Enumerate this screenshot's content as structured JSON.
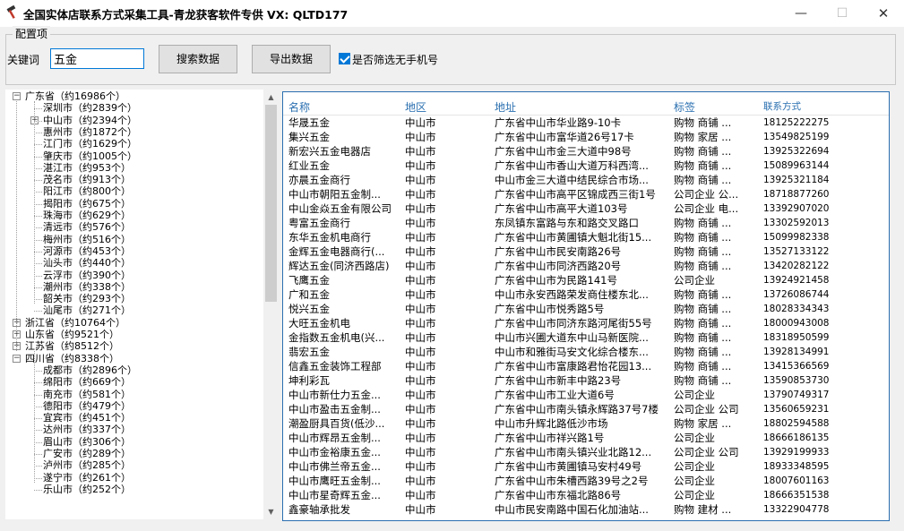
{
  "window": {
    "title": "全国实体店联系方式采集工具-青龙获客软件专供 VX:  QLTD177",
    "minimize": "—",
    "maximize": "☐",
    "close": "✕"
  },
  "config": {
    "group_label": "配置项",
    "keyword_label": "关键词",
    "keyword_value": "五金",
    "search_button": "搜索数据",
    "export_button": "导出数据",
    "filter_checkbox_label": "是否筛选无手机号",
    "filter_checked": true
  },
  "tree": [
    {
      "label": "广东省（约16986个）",
      "level": 0,
      "exp": "−"
    },
    {
      "label": "深圳市（约2839个）",
      "level": 1,
      "exp": ""
    },
    {
      "label": "中山市（约2394个）",
      "level": 1,
      "exp": "+"
    },
    {
      "label": "惠州市（约1872个）",
      "level": 1,
      "exp": ""
    },
    {
      "label": "江门市（约1629个）",
      "level": 1,
      "exp": ""
    },
    {
      "label": "肇庆市（约1005个）",
      "level": 1,
      "exp": ""
    },
    {
      "label": "湛江市（约953个）",
      "level": 1,
      "exp": ""
    },
    {
      "label": "茂名市（约913个）",
      "level": 1,
      "exp": ""
    },
    {
      "label": "阳江市（约800个）",
      "level": 1,
      "exp": ""
    },
    {
      "label": "揭阳市（约675个）",
      "level": 1,
      "exp": ""
    },
    {
      "label": "珠海市（约629个）",
      "level": 1,
      "exp": ""
    },
    {
      "label": "清远市（约576个）",
      "level": 1,
      "exp": ""
    },
    {
      "label": "梅州市（约516个）",
      "level": 1,
      "exp": ""
    },
    {
      "label": "河源市（约453个）",
      "level": 1,
      "exp": ""
    },
    {
      "label": "汕头市（约440个）",
      "level": 1,
      "exp": ""
    },
    {
      "label": "云浮市（约390个）",
      "level": 1,
      "exp": ""
    },
    {
      "label": "潮州市（约338个）",
      "level": 1,
      "exp": ""
    },
    {
      "label": "韶关市（约293个）",
      "level": 1,
      "exp": ""
    },
    {
      "label": "汕尾市（约271个）",
      "level": 1,
      "exp": ""
    },
    {
      "label": "浙江省（约10764个）",
      "level": 0,
      "exp": "+"
    },
    {
      "label": "山东省（约9521个）",
      "level": 0,
      "exp": "+"
    },
    {
      "label": "江苏省（约8512个）",
      "level": 0,
      "exp": "+"
    },
    {
      "label": "四川省（约8338个）",
      "level": 0,
      "exp": "−"
    },
    {
      "label": "成都市（约2896个）",
      "level": 1,
      "exp": ""
    },
    {
      "label": "绵阳市（约669个）",
      "level": 1,
      "exp": ""
    },
    {
      "label": "南充市（约581个）",
      "level": 1,
      "exp": ""
    },
    {
      "label": "德阳市（约479个）",
      "level": 1,
      "exp": ""
    },
    {
      "label": "宜宾市（约451个）",
      "level": 1,
      "exp": ""
    },
    {
      "label": "达州市（约337个）",
      "level": 1,
      "exp": ""
    },
    {
      "label": "眉山市（约306个）",
      "level": 1,
      "exp": ""
    },
    {
      "label": "广安市（约289个）",
      "level": 1,
      "exp": ""
    },
    {
      "label": "泸州市（约285个）",
      "level": 1,
      "exp": ""
    },
    {
      "label": "遂宁市（约261个）",
      "level": 1,
      "exp": ""
    },
    {
      "label": "乐山市（约252个）",
      "level": 1,
      "exp": ""
    }
  ],
  "list": {
    "headers": [
      "名称",
      "地区",
      "地址",
      "标签",
      "联系方式"
    ],
    "rows": [
      [
        "华晟五金",
        "中山市",
        "广东省中山市华业路9-10卡",
        "购物 商铺 ...",
        "18125222275"
      ],
      [
        "集兴五金",
        "中山市",
        "广东省中山市富华道26号17卡",
        "购物 家居 ...",
        "13549825199"
      ],
      [
        "新宏兴五金电器店",
        "中山市",
        "广东省中山市金三大道中98号",
        "购物 商铺 ...",
        "13925322694"
      ],
      [
        "红业五金",
        "中山市",
        "广东省中山市香山大道万科西湾...",
        "购物 商铺 ...",
        "15089963144"
      ],
      [
        "亦晨五金商行",
        "中山市",
        "中山市金三大道中结民综合市场...",
        "购物 商铺 ...",
        "13925321184"
      ],
      [
        "中山市朝阳五金制...",
        "中山市",
        "广东省中山市高平区锦成西三街1号",
        "公司企业 公...",
        "18718877260"
      ],
      [
        "中山金焱五金有限公司",
        "中山市",
        "广东省中山市高平大道103号",
        "公司企业 电...",
        "13392907020"
      ],
      [
        "粤富五金商行",
        "中山市",
        "东凤镇东富路与东和路交叉路口",
        "购物 商铺 ...",
        "13302592013"
      ],
      [
        "东华五金机电商行",
        "中山市",
        "广东省中山市黄圃镇大魁北街15...",
        "购物 商铺 ...",
        "15099982338"
      ],
      [
        "金辉五金电器商行(...",
        "中山市",
        "广东省中山市民安南路26号",
        "购物 商铺 ...",
        "13527133122"
      ],
      [
        "辉达五金(同济西路店)",
        "中山市",
        "广东省中山市同济西路20号",
        "购物 商铺 ...",
        "13420282122"
      ],
      [
        "飞鹰五金",
        "中山市",
        "广东省中山市为民路141号",
        "公司企业",
        "13924921458"
      ],
      [
        "广和五金",
        "中山市",
        "中山市永安西路荣发商住楼东北...",
        "购物 商铺 ...",
        "13726086744"
      ],
      [
        "悦兴五金",
        "中山市",
        "广东省中山市悦秀路5号",
        "购物 商铺 ...",
        "18028334343"
      ],
      [
        "大旺五金机电",
        "中山市",
        "广东省中山市同济东路河尾街55号",
        "购物 商铺 ...",
        "18000943008"
      ],
      [
        "金指数五金机电(兴...",
        "中山市",
        "中山市兴圃大道东中山马新医院...",
        "购物 商铺 ...",
        "18318950599"
      ],
      [
        "翡宏五金",
        "中山市",
        "中山市和雅街马安文化综合楼东...",
        "购物 商铺 ...",
        "13928134991"
      ],
      [
        "信鑫五金装饰工程部",
        "中山市",
        "广东省中山市富康路君怡花园13...",
        "购物 商铺 ...",
        "13415366569"
      ],
      [
        "坤利彩瓦",
        "中山市",
        "广东省中山市新丰中路23号",
        "购物 商铺 ...",
        "13590853730"
      ],
      [
        "中山市新仕力五金...",
        "中山市",
        "广东省中山市工业大道6号",
        "公司企业",
        "13790749317"
      ],
      [
        "中山市盈击五金制...",
        "中山市",
        "广东省中山市南头镇永辉路37号7楼",
        "公司企业 公司",
        "13560659231"
      ],
      [
        "潮盈厨具百货(低沙...",
        "中山市",
        "中山市升辉北路低沙市场",
        "购物 家居 ...",
        "18802594588"
      ],
      [
        "中山市辉昂五金制...",
        "中山市",
        "广东省中山市祥兴路1号",
        "公司企业",
        "18666186135"
      ],
      [
        "中山市金裕康五金...",
        "中山市",
        "广东省中山市南头镇兴业北路12...",
        "公司企业 公司",
        "13929199933"
      ],
      [
        "中山市佛兰帝五金...",
        "中山市",
        "广东省中山市黄圃镇马安村49号",
        "公司企业",
        "18933348595"
      ],
      [
        "中山市鹰旺五金制...",
        "中山市",
        "广东省中山市朱槽西路39号之2号",
        "公司企业",
        "18007601163"
      ],
      [
        "中山市星奇辉五金...",
        "中山市",
        "广东省中山市东福北路86号",
        "公司企业",
        "18666351538"
      ],
      [
        "鑫豪轴承批发",
        "中山市",
        "中山市民安南路中国石化加油站...",
        "购物 建材 ...",
        "13322904778"
      ]
    ]
  }
}
